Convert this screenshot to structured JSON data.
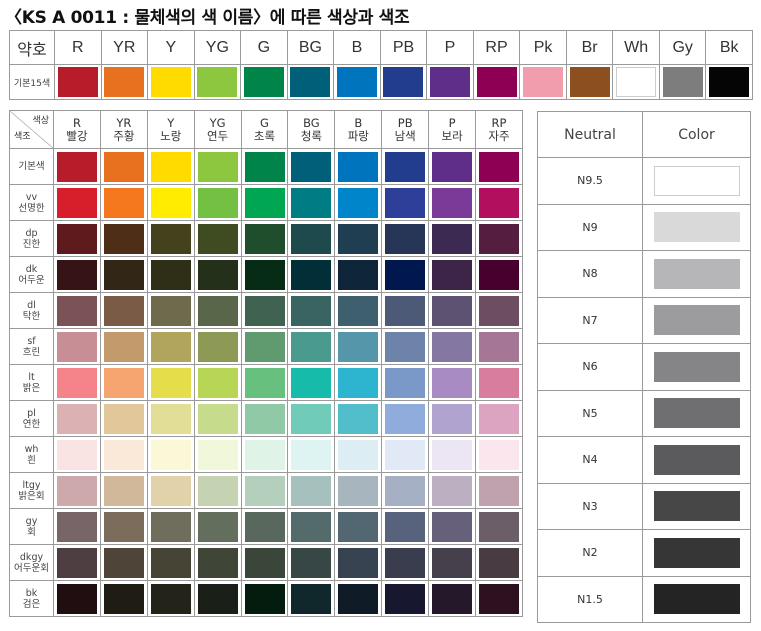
{
  "title": "〈KS A 0011 : 물체색의 색 이름〉에 따른 색상과 색조",
  "top_table": {
    "header_label": "약호",
    "row_label": "기본15색",
    "columns": [
      {
        "code": "R",
        "color": "#B71C2B"
      },
      {
        "code": "YR",
        "color": "#E8711F"
      },
      {
        "code": "Y",
        "color": "#FFDB00"
      },
      {
        "code": "YG",
        "color": "#8DC63F"
      },
      {
        "code": "G",
        "color": "#00844A"
      },
      {
        "code": "BG",
        "color": "#00607A"
      },
      {
        "code": "B",
        "color": "#0075BE"
      },
      {
        "code": "PB",
        "color": "#233D8E"
      },
      {
        "code": "P",
        "color": "#5E2E88"
      },
      {
        "code": "RP",
        "color": "#8E0053"
      },
      {
        "code": "Pk",
        "color": "#F29DAE"
      },
      {
        "code": "Br",
        "color": "#8C4F1F"
      },
      {
        "code": "Wh",
        "color": "#FFFFFF"
      },
      {
        "code": "Gy",
        "color": "#7D7D7D"
      },
      {
        "code": "Bk",
        "color": "#050505"
      }
    ]
  },
  "main_table": {
    "corner_top": "색상",
    "corner_bottom": "색조",
    "hues": [
      {
        "code": "R",
        "name": "빨강"
      },
      {
        "code": "YR",
        "name": "주황"
      },
      {
        "code": "Y",
        "name": "노랑"
      },
      {
        "code": "YG",
        "name": "연두"
      },
      {
        "code": "G",
        "name": "초록"
      },
      {
        "code": "BG",
        "name": "청록"
      },
      {
        "code": "B",
        "name": "파랑"
      },
      {
        "code": "PB",
        "name": "남색"
      },
      {
        "code": "P",
        "name": "보라"
      },
      {
        "code": "RP",
        "name": "자주"
      }
    ],
    "rows": [
      {
        "abbr": "",
        "name": "기본색",
        "colors": [
          "#B71C2B",
          "#E8711F",
          "#FFDB00",
          "#8DC63F",
          "#00844A",
          "#00607A",
          "#0075BE",
          "#233D8E",
          "#5E2E88",
          "#8E0053"
        ]
      },
      {
        "abbr": "vv",
        "name": "선명한",
        "colors": [
          "#D71F2B",
          "#F6781E",
          "#FFEC00",
          "#74C043",
          "#00A651",
          "#007C85",
          "#0085CA",
          "#2E3F99",
          "#7B3A98",
          "#B2105F"
        ]
      },
      {
        "abbr": "dp",
        "name": "진한",
        "colors": [
          "#5E1A1D",
          "#4E2E17",
          "#43421D",
          "#3F4C22",
          "#1F4E2D",
          "#1E4A4E",
          "#1F3E52",
          "#273656",
          "#3D2A52",
          "#551D3F"
        ]
      },
      {
        "abbr": "dk",
        "name": "어두운",
        "colors": [
          "#361315",
          "#322617",
          "#2F2E17",
          "#25301A",
          "#062C16",
          "#022E37",
          "#0F2539",
          "#01184F",
          "#3D2547",
          "#48012F"
        ]
      },
      {
        "abbr": "dl",
        "name": "탁한",
        "colors": [
          "#7B5357",
          "#7A5B46",
          "#6E6A4B",
          "#59664A",
          "#3F6350",
          "#3A6462",
          "#3E5F6D",
          "#4D5A77",
          "#5E5272",
          "#6C4E60"
        ]
      },
      {
        "abbr": "sf",
        "name": "흐린",
        "colors": [
          "#C88E96",
          "#C39A6C",
          "#B1A55E",
          "#8C9A55",
          "#5F9B6E",
          "#4A9A90",
          "#5596AA",
          "#6D83A9",
          "#8478A3",
          "#A57695"
        ]
      },
      {
        "abbr": "lt",
        "name": "밝은",
        "colors": [
          "#F5838A",
          "#F6A570",
          "#E5DE4A",
          "#B7D655",
          "#67C07D",
          "#16BBA9",
          "#2DB4CF",
          "#7B99C8",
          "#A98BC4",
          "#D97D9E"
        ]
      },
      {
        "abbr": "pl",
        "name": "연한",
        "colors": [
          "#DCB1B3",
          "#E2C79B",
          "#E2DD97",
          "#C6DC8C",
          "#8FC9A5",
          "#71CBB9",
          "#53BECB",
          "#8FACDC",
          "#B1A3CF",
          "#DCA4C0"
        ]
      },
      {
        "abbr": "wh",
        "name": "흰",
        "colors": [
          "#F9E4E3",
          "#FAE8D8",
          "#FBF8D7",
          "#F1F7DA",
          "#DFF3E6",
          "#DDF4F3",
          "#DCEEF4",
          "#E2E9F6",
          "#ECE6F4",
          "#FCE6EE"
        ]
      },
      {
        "abbr": "ltgy",
        "name": "밝은회",
        "colors": [
          "#CEA9AC",
          "#D1B89A",
          "#E1D2AA",
          "#C5D3B2",
          "#B4CFBC",
          "#A6C0BD",
          "#A7B5BF",
          "#A5B0C4",
          "#BCAFC2",
          "#C0A1AE"
        ]
      },
      {
        "abbr": "gy",
        "name": "회",
        "colors": [
          "#776568",
          "#7C6C5C",
          "#6F6D5B",
          "#646E5C",
          "#59685D",
          "#546B6C",
          "#536772",
          "#57637C",
          "#67607A",
          "#6C5E68"
        ]
      },
      {
        "abbr": "dkgy",
        "name": "어두운회",
        "colors": [
          "#4E3E41",
          "#4E4438",
          "#454435",
          "#3F4537",
          "#3A4639",
          "#364746",
          "#384351",
          "#3A3D4E",
          "#46404D",
          "#483B42"
        ]
      },
      {
        "abbr": "bk",
        "name": "검은",
        "colors": [
          "#200E10",
          "#1F1C13",
          "#23231A",
          "#1A2018",
          "#041C0E",
          "#10272C",
          "#0F1C28",
          "#17182F",
          "#25182B",
          "#2D1121"
        ]
      }
    ]
  },
  "neutral_table": {
    "header_neutral": "Neutral",
    "header_color": "Color",
    "rows": [
      {
        "label": "N9.5",
        "color": "#FFFFFF"
      },
      {
        "label": "N9",
        "color": "#D9D9DA"
      },
      {
        "label": "N8",
        "color": "#B6B6B8"
      },
      {
        "label": "N7",
        "color": "#9C9C9E"
      },
      {
        "label": "N6",
        "color": "#858587"
      },
      {
        "label": "N5",
        "color": "#6F6F71"
      },
      {
        "label": "N4",
        "color": "#5B5B5D"
      },
      {
        "label": "N3",
        "color": "#474748"
      },
      {
        "label": "N2",
        "color": "#363637"
      },
      {
        "label": "N1.5",
        "color": "#242424"
      }
    ]
  }
}
